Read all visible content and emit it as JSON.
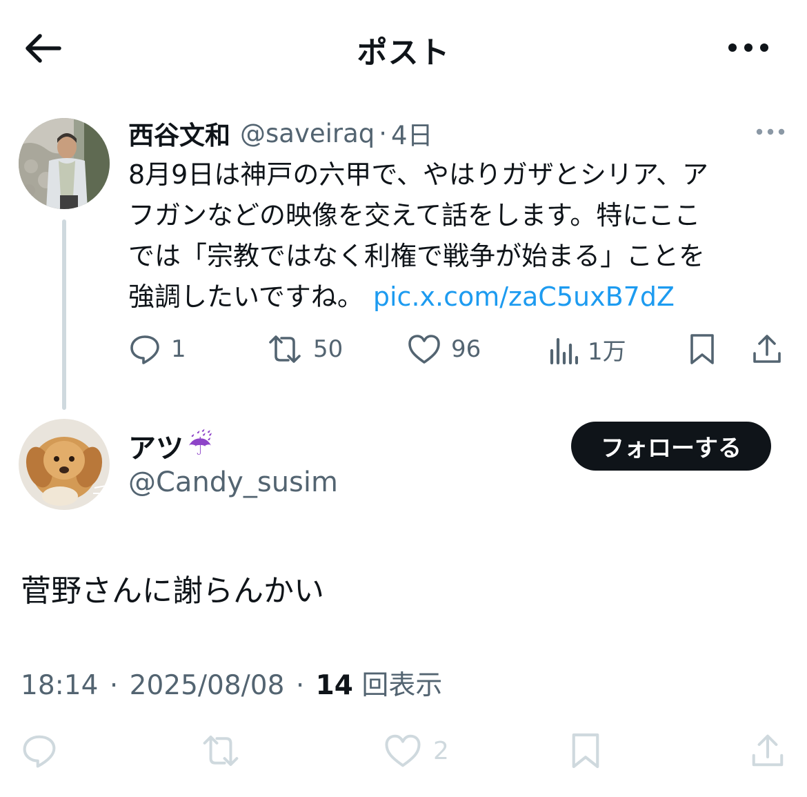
{
  "header": {
    "title": "ポスト"
  },
  "quoted_post": {
    "display_name": "西谷文和",
    "handle": "@saveiraq",
    "separator": "·",
    "time": "4日",
    "text": "8月9日は神戸の六甲で、やはりガザとシリア、ア\nフガンなどの映像を交えて話をします。特にここ\nでは「宗教ではなく利権で戦争が始まる」ことを\n強調したいですね。",
    "link": "pic.x.com/zaC5uxB7dZ",
    "stats": {
      "replies": "1",
      "reposts": "50",
      "likes": "96",
      "views": "1万"
    }
  },
  "reply": {
    "display_name": "アツ",
    "name_emoji": "☔",
    "handle": "@Candy_susim",
    "follow_label": "フォローする",
    "text": "菅野さんに謝らんかい",
    "time": "18:14",
    "date": "2025/08/08",
    "separator": "·",
    "views_count": "14",
    "views_label": "回表示",
    "stats": {
      "likes": "2"
    }
  },
  "colors": {
    "text": "#0f1419",
    "secondary": "#536471",
    "link": "#1d9bf0",
    "disabled": "#cfd9de",
    "button_bg": "#0f1419"
  },
  "icons": {
    "back": "arrow-left-icon",
    "more": "more-horizontal-icon",
    "reply": "reply-icon",
    "repost": "repost-icon",
    "like": "heart-icon",
    "views": "views-icon",
    "bookmark": "bookmark-icon",
    "share": "share-icon"
  }
}
